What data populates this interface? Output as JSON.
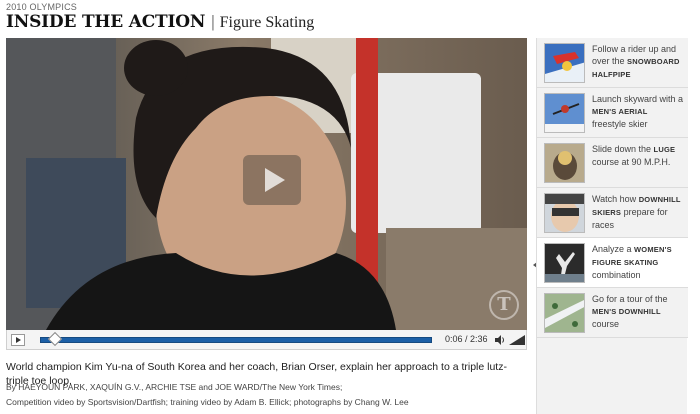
{
  "header": {
    "kicker": "2010 OLYMPICS",
    "title": "INSIDE THE ACTION",
    "separator": "|",
    "subtitle": "Figure Skating"
  },
  "player": {
    "elapsed": "0:06",
    "duration": "2:36",
    "time_text": "0:06 / 2:36",
    "progress_fraction": 0.038,
    "watermark": "T"
  },
  "caption": "World champion Kim Yu-na of South Korea and her coach, Brian Orser, explain her approach to a triple lutz-triple toe loop.",
  "credits": {
    "line1": "By HAEYOUN PARK, XAQUÍN G.V., ARCHIE TSE and JOE WARD/The New York Times;",
    "line2": "Competition video by Sportsvision/Dartfish; training video by Adam B. Ellick; photographs by Chang W. Lee"
  },
  "sidebar": {
    "items": [
      {
        "pre": "Follow a rider up and over the ",
        "bold": "SNOWBOARD HALFPIPE",
        "post": "",
        "icon": "snowboard-thumb-icon",
        "active": false
      },
      {
        "pre": "Launch skyward with a ",
        "bold": "MEN'S AERIAL",
        "post": " freestyle skier",
        "icon": "aerial-skier-thumb-icon",
        "active": false
      },
      {
        "pre": "Slide down the ",
        "bold": "LUGE",
        "post": " course at 90 M.P.H.",
        "icon": "luge-thumb-icon",
        "active": false
      },
      {
        "pre": "Watch how ",
        "bold": "DOWNHILL SKIERS",
        "post": " prepare for races",
        "icon": "downhill-skier-thumb-icon",
        "active": false
      },
      {
        "pre": "Analyze a ",
        "bold": "WOMEN'S FIGURE SKATING",
        "post": " combination",
        "icon": "figure-skater-thumb-icon",
        "active": true
      },
      {
        "pre": "Go for a tour of the ",
        "bold": "MEN'S DOWNHILL",
        "post": " course",
        "icon": "course-map-thumb-icon",
        "active": false
      }
    ]
  },
  "colors": {
    "progress_fill": "#1c5fa6",
    "sidebar_bg": "#f2f2f2",
    "active_item_bg": "#ffffff"
  }
}
